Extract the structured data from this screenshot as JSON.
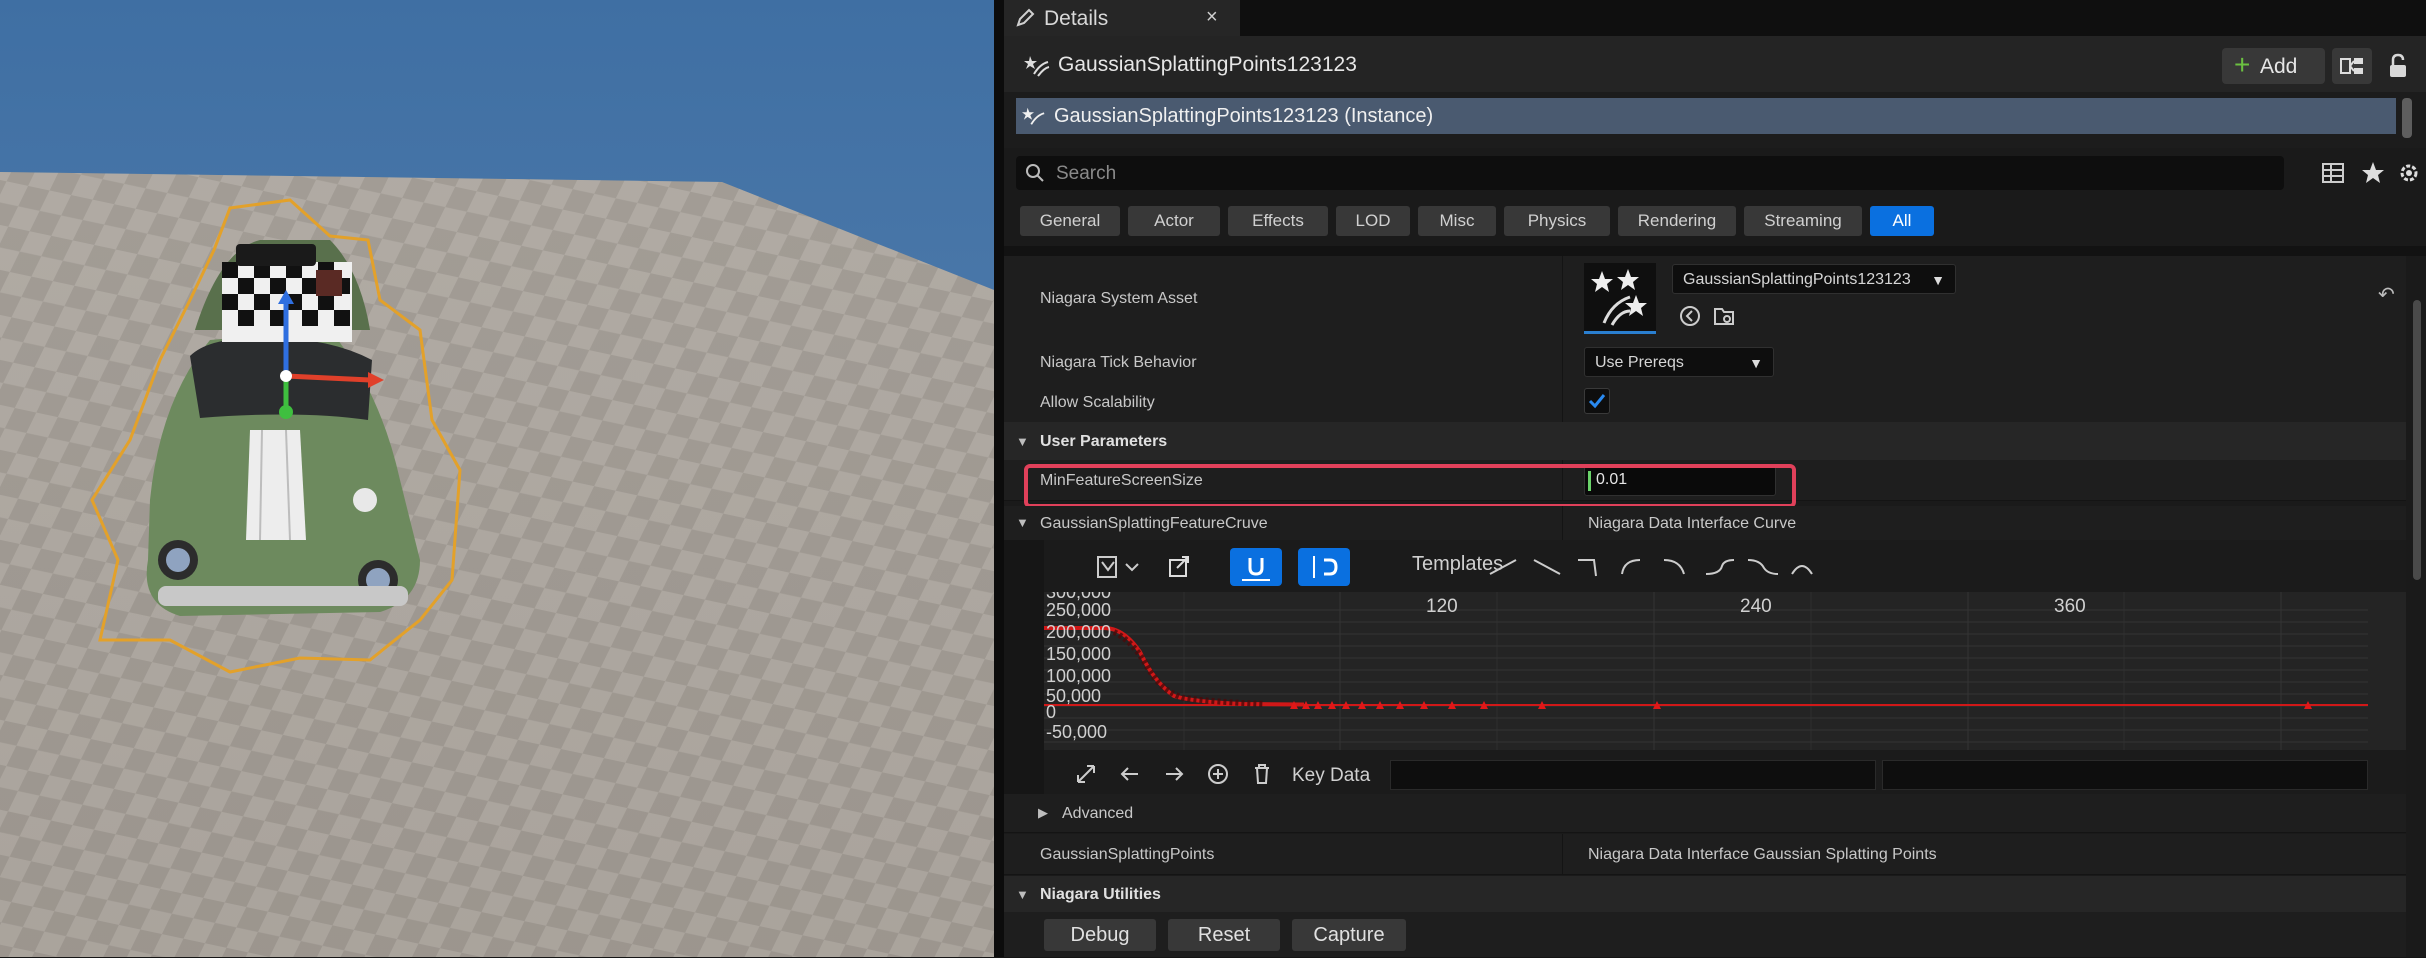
{
  "tab": {
    "title": "Details",
    "close": "×"
  },
  "header": {
    "actor_name": "GaussianSplattingPoints123123",
    "add_label": "Add"
  },
  "component": {
    "selected": "GaussianSplattingPoints123123 (Instance)"
  },
  "search": {
    "placeholder": "Search"
  },
  "filters": [
    "General",
    "Actor",
    "Effects",
    "LOD",
    "Misc",
    "Physics",
    "Rendering",
    "Streaming",
    "All"
  ],
  "filters_active": "All",
  "properties": {
    "niagara_system_asset": {
      "label": "Niagara System Asset",
      "value": "GaussianSplattingPoints123123"
    },
    "niagara_tick_behavior": {
      "label": "Niagara Tick Behavior",
      "value": "Use Prereqs"
    },
    "allow_scalability": {
      "label": "Allow Scalability",
      "checked": true
    }
  },
  "user_parameters": {
    "header": "User Parameters",
    "min_feature_screen_size": {
      "label": "MinFeatureScreenSize",
      "value": "0.01"
    },
    "feature_curve": {
      "label": "GaussianSplattingFeatureCruve",
      "value": "Niagara Data Interface Curve"
    },
    "advanced": "Advanced",
    "splatting_points": {
      "label": "GaussianSplattingPoints",
      "value": "Niagara Data Interface Gaussian Splatting Points"
    }
  },
  "curve_editor": {
    "templates_label": "Templates",
    "key_data_label": "Key Data",
    "x_ticks": [
      "120",
      "240",
      "360"
    ],
    "y_ticks": [
      "300,000",
      "250,000",
      "200,000",
      "150,000",
      "100,000",
      "50,000",
      "0",
      "-50,000"
    ]
  },
  "utilities": {
    "header": "Niagara Utilities",
    "buttons": [
      "Debug",
      "Reset",
      "Capture"
    ]
  },
  "colors": {
    "accent": "#0a70e0",
    "highlight": "#e0405a",
    "curve": "#d01818"
  }
}
